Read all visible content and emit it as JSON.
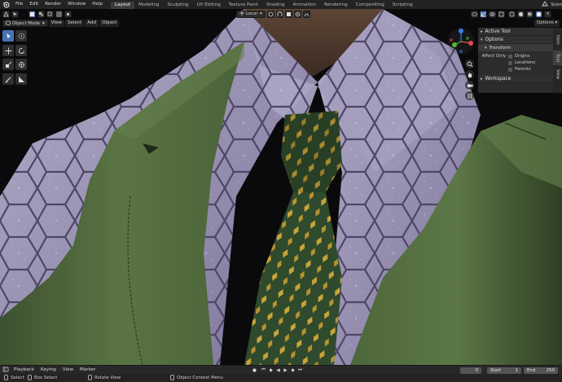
{
  "menubar": {
    "logo_icon": "blender-logo-icon",
    "items": [
      "File",
      "Edit",
      "Render",
      "Window",
      "Help"
    ],
    "workspaces": [
      "Layout",
      "Modeling",
      "Sculpting",
      "UV Editing",
      "Texture Paint",
      "Shading",
      "Animation",
      "Rendering",
      "Compositing",
      "Scripting"
    ],
    "active_workspace": "Layout",
    "scene_label": "Scen"
  },
  "viewport_tools": {
    "orientation": "Local"
  },
  "viewport_header": {
    "mode": "Object Mode",
    "menus": [
      "View",
      "Select",
      "Add",
      "Object"
    ],
    "options": "Options"
  },
  "npanel": {
    "active_tool": "Active Tool",
    "options": "Options",
    "transform": "Transform",
    "affect_only": "Affect Only",
    "checkboxes": [
      "Origins",
      "Locations",
      "Parents"
    ],
    "workspace": "Workspace",
    "tabs": [
      "Item",
      "Tool",
      "View"
    ],
    "active_tab": "Tool"
  },
  "timeline": {
    "menus": [
      "Playback",
      "Keying",
      "View",
      "Marker"
    ],
    "current_frame": "0",
    "start_label": "Start",
    "start": "1",
    "end_label": "End",
    "end": "250"
  },
  "statusbar": {
    "items": [
      "Select",
      "Box Select",
      "Rotate View",
      "Object Context Menu"
    ]
  },
  "colors": {
    "accent": "#4772b3",
    "jacket": "#55703f",
    "shirt": "#9a93b8",
    "tie": "#2f4a2c",
    "tie_pattern": "#c9a43a"
  }
}
